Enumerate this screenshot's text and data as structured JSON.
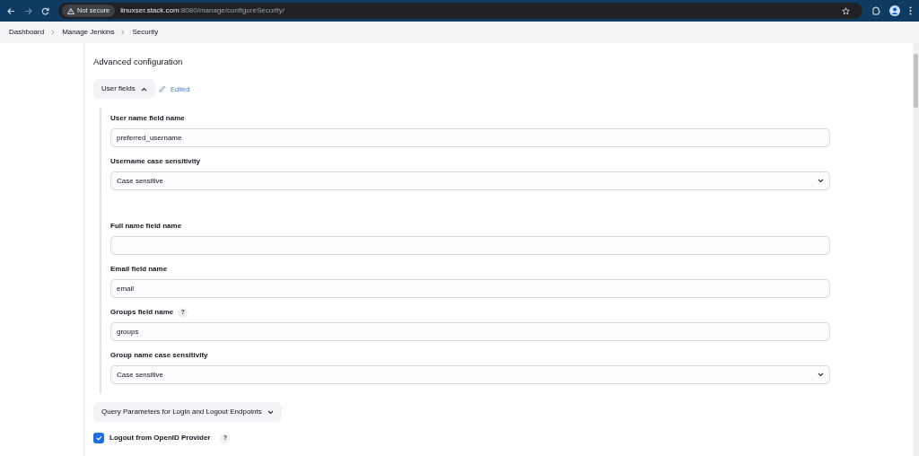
{
  "browser": {
    "security_label": "Not secure",
    "url_host": "linuxser.stack.com",
    "url_rest": ":8080/manage/configureSecurity/"
  },
  "breadcrumbs": [
    "Dashboard",
    "Manage Jenkins",
    "Security"
  ],
  "section_title": "Advanced configuration",
  "user_fields_toggle": {
    "label": "User fields",
    "expanded": true
  },
  "edited_label": "Edited",
  "fields": [
    {
      "label": "User name field name",
      "kind": "text",
      "value": "preferred_username"
    },
    {
      "label": "Username case sensitivity",
      "kind": "select",
      "value": "Case sensitive"
    },
    {
      "label": "Full name field name",
      "kind": "text"
    },
    {
      "label": "Email field name",
      "kind": "text",
      "value": "email"
    },
    {
      "label": "Groups field name",
      "kind": "text",
      "value": "groups",
      "help": "?"
    },
    {
      "label": "Group name case sensitivity",
      "kind": "select",
      "value": "Case sensitive"
    }
  ],
  "query_toggle": {
    "label": "Query Parameters for Login and Logout Endpoints",
    "expanded": false
  },
  "logout": {
    "label": "Logout from OpenID Provider",
    "checked": true,
    "help": "?"
  }
}
